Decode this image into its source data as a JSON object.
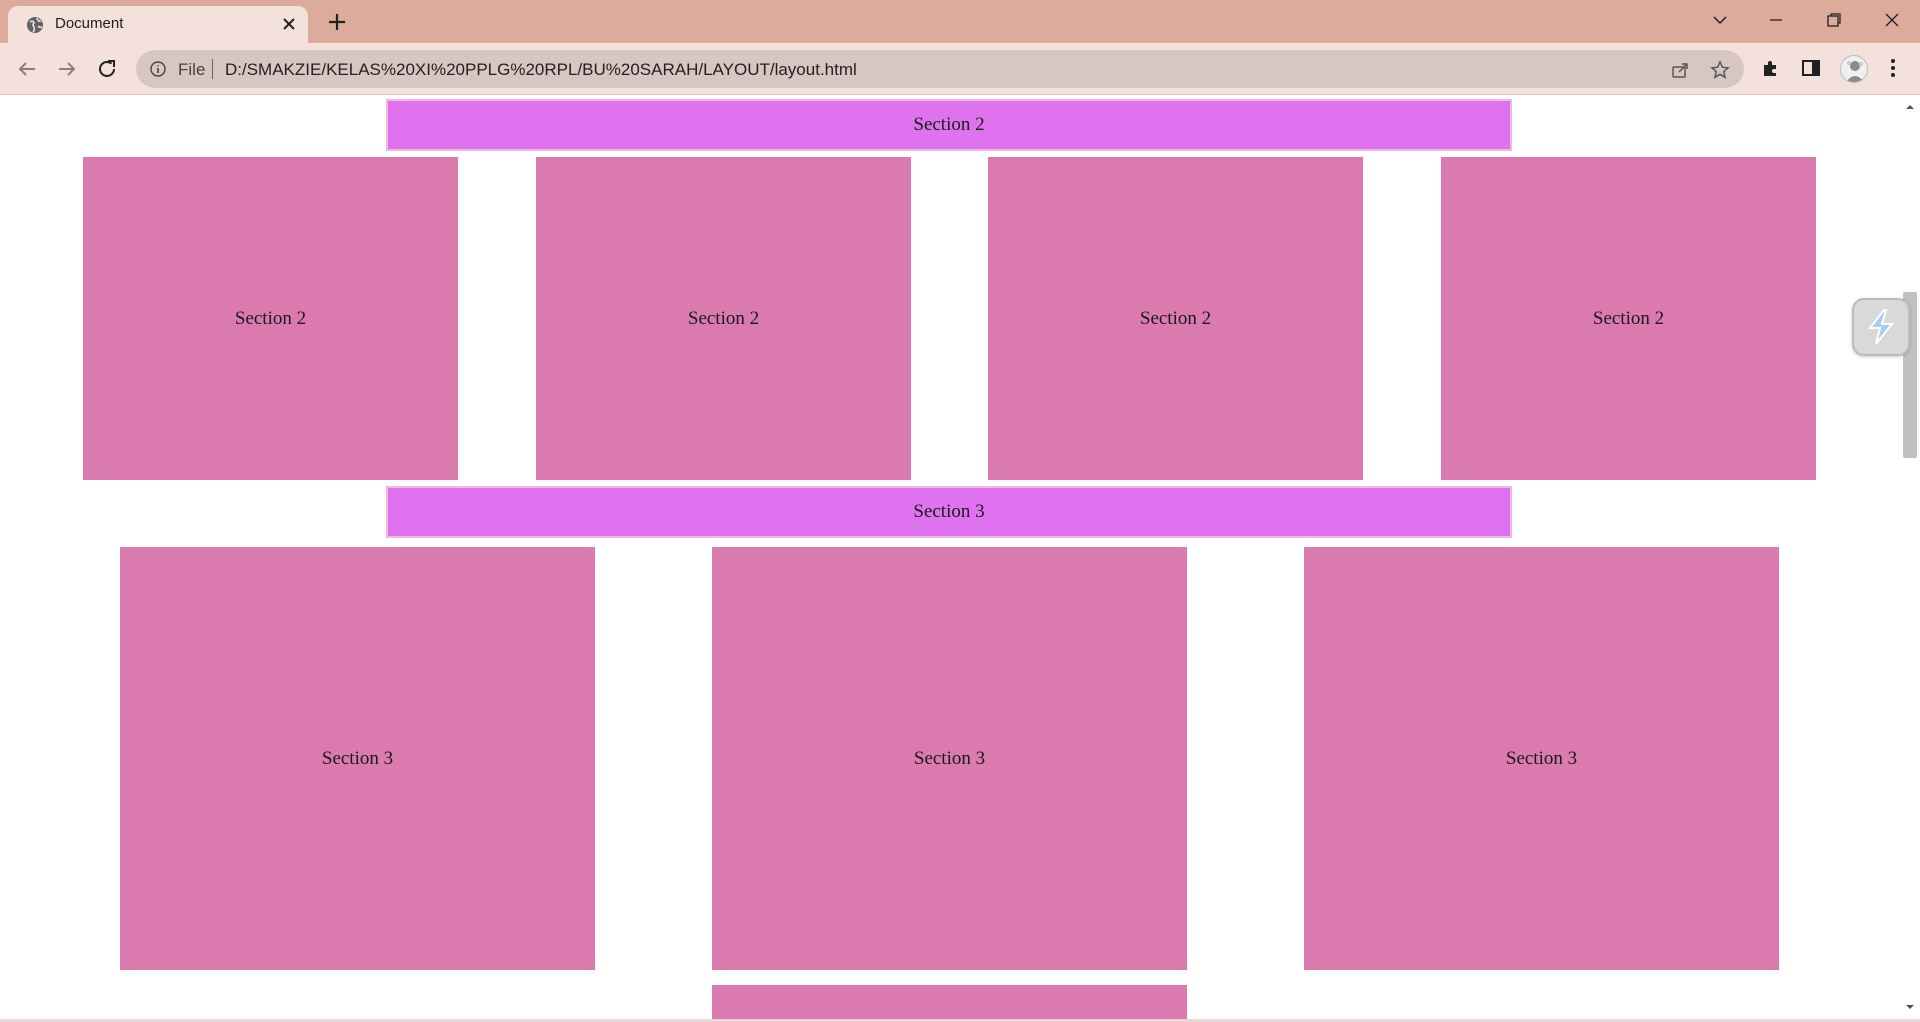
{
  "browser": {
    "tab_title": "Document",
    "address_scheme": "File",
    "address_url": "D:/SMAKZIE/KELAS%20XI%20PPLG%20RPL/BU%20SARAH/LAYOUT/layout.html"
  },
  "page": {
    "section2_header": "Section 2",
    "section2_cards": [
      "Section 2",
      "Section 2",
      "Section 2",
      "Section 2"
    ],
    "section3_header": "Section 3",
    "section3_cards": [
      "Section 3",
      "Section 3",
      "Section 3"
    ]
  },
  "colors": {
    "titlebar": "#dcab9c",
    "toolbar": "#f4e1dc",
    "header_fill": "#df72ee",
    "header_border": "#f2b8dc",
    "card_fill": "#db7aaf"
  }
}
